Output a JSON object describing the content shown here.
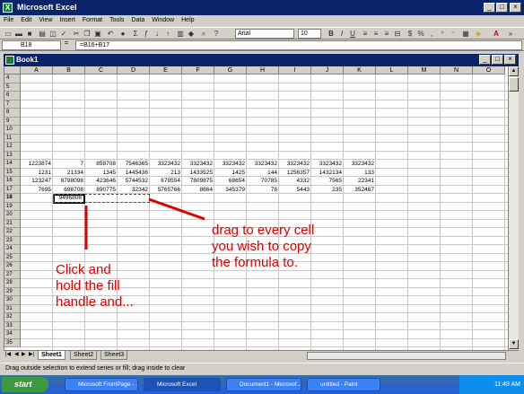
{
  "window": {
    "title": "Microsoft Excel"
  },
  "menu": [
    "File",
    "Edit",
    "View",
    "Insert",
    "Format",
    "Tools",
    "Data",
    "Window",
    "Help"
  ],
  "toolbar": {
    "font": "Arial",
    "size": "10",
    "zoom": ""
  },
  "formula_bar": {
    "name_box": "B18",
    "equals": "=",
    "formula": "=B16+B17"
  },
  "workbook": {
    "title": "Book1"
  },
  "columns": [
    "A",
    "B",
    "C",
    "D",
    "E",
    "F",
    "G",
    "H",
    "I",
    "J",
    "K",
    "L",
    "M",
    "N",
    "O"
  ],
  "rows": [
    "4",
    "5",
    "6",
    "7",
    "8",
    "9",
    "10",
    "11",
    "12",
    "13",
    "14",
    "15",
    "16",
    "17",
    "18",
    "19",
    "20",
    "21",
    "22",
    "23",
    "24",
    "25",
    "26",
    "27",
    "28",
    "29",
    "30",
    "31",
    "32",
    "33",
    "34",
    "35"
  ],
  "cells": {
    "14": [
      "1223874",
      "7",
      "858708",
      "7546365",
      "3323432",
      "3323432",
      "3323432",
      "3323432",
      "3323432",
      "3323432",
      "3323432"
    ],
    "15": [
      "1231",
      "21334",
      "1345",
      "1445436",
      "213",
      "1433525",
      "1425",
      "144",
      "1256357",
      "1432134",
      "133"
    ],
    "16": [
      "123247",
      "8798098",
      "423646",
      "5744532",
      "679554",
      "7809875",
      "68654",
      "70785",
      "4332",
      "7565",
      "22341"
    ],
    "17": [
      "7695",
      "698708",
      "890775",
      "32342",
      "5765766",
      "8664",
      "345379",
      "78",
      "5443",
      "235",
      "352467"
    ],
    "18": [
      "",
      "9496806",
      "",
      "",
      "",
      "",
      "",
      "",
      "",
      "",
      ""
    ]
  },
  "sheet_tabs": [
    "Sheet1",
    "Sheet2",
    "Sheet3"
  ],
  "status": "Drag outside selection to extend series or fill; drag inside to clear",
  "annotations": {
    "left": [
      "Click and",
      "hold the fill",
      "handle and..."
    ],
    "right": [
      "drag to every cell",
      "you wish to copy",
      "the formula to."
    ]
  },
  "taskbar": {
    "start": "start",
    "tasks": [
      "Microsoft FrontPage - ...",
      "Microsoft Excel",
      "Document1 - Microsof...",
      "untitled - Paint"
    ],
    "clock": "11:49 AM"
  },
  "colors": {
    "title_bar": "#0a246a",
    "annotation": "#e00000"
  }
}
